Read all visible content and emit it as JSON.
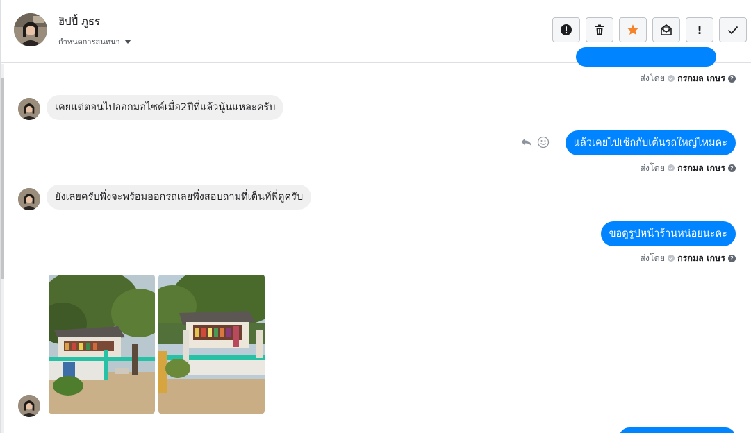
{
  "contact": {
    "name": "ฮิปปี้ ภูธร",
    "assign_label": "กำหนดการสนทนา"
  },
  "toolbar": {
    "buttons": [
      {
        "name": "mark-spam-button",
        "icon": "alert-circle-icon"
      },
      {
        "name": "delete-button",
        "icon": "trash-icon"
      },
      {
        "name": "star-button",
        "icon": "star-icon"
      },
      {
        "name": "mark-unread-button",
        "icon": "envelope-open-icon"
      },
      {
        "name": "follow-up-button",
        "icon": "exclamation-icon",
        "label": "!"
      },
      {
        "name": "mark-done-button",
        "icon": "checkmark-icon"
      }
    ],
    "star_color": "#f5832a"
  },
  "sent_by": {
    "prefix": "ส่งโดย",
    "sender": "กรกมล เกษร"
  },
  "messages": [
    {
      "direction": "in",
      "text": "เคยแต่ตอนไปออกมอไซค์เมื่อ2ปีที่แล้วนู้นแหละครับ"
    },
    {
      "direction": "out",
      "text": "แล้วเคยไปเช้กกับเต้นรถใหญ่ไหมคะ"
    },
    {
      "direction": "in",
      "text": "ยังเลยครับพึ่งจะพร้อมออกรถเลยพึ่งสอบถามที่เต็นท์พี่ดูครับ"
    },
    {
      "direction": "out",
      "text": "ขอดูรูปหน้าร้านหน่อยนะคะ"
    },
    {
      "direction": "in",
      "type": "photos",
      "count": 2
    }
  ],
  "colors": {
    "outgoing_bubble": "#0084ff",
    "incoming_bubble": "#f1f0f0"
  }
}
